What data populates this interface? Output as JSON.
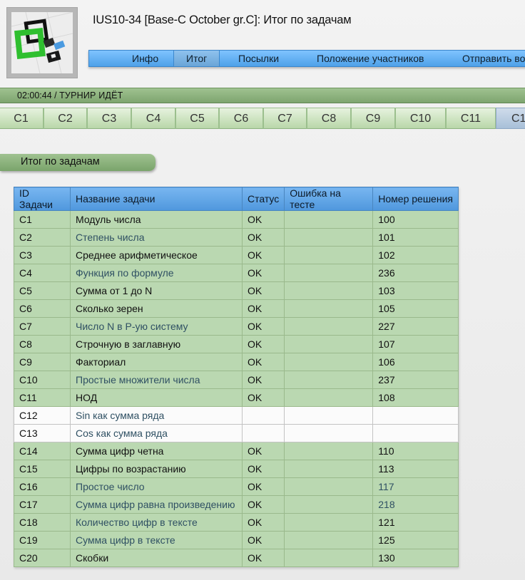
{
  "header": {
    "title": "IUS10-34 [Base-C October gr.C]: Итог по задачам"
  },
  "menu": [
    {
      "label": "Инфо",
      "active": false
    },
    {
      "label": "Итог",
      "active": true
    },
    {
      "label": "Посылки",
      "active": false
    },
    {
      "label": "Положение участников",
      "active": false
    },
    {
      "label": "Отправить во",
      "active": false
    }
  ],
  "status": {
    "time": "02:00:44",
    "separator": " / ",
    "state": "ТУРНИР ИДЁТ"
  },
  "tabs": [
    "C1",
    "C2",
    "C3",
    "C4",
    "C5",
    "C6",
    "C7",
    "C8",
    "C9",
    "C10",
    "C11",
    "C1"
  ],
  "section": {
    "heading": "Итог по задачам"
  },
  "table": {
    "headers": [
      "ID Задачи",
      "Название задачи",
      "Статус",
      "Ошибка на тесте",
      "Номер решения"
    ],
    "rows": [
      {
        "id": "C1",
        "name": "Модуль числа",
        "status": "OK",
        "error": "",
        "solution": "100",
        "solved": true,
        "name_dim": false,
        "num_dim": false
      },
      {
        "id": "C2",
        "name": "Степень числа",
        "status": "OK",
        "error": "",
        "solution": "101",
        "solved": true,
        "name_dim": true,
        "num_dim": false
      },
      {
        "id": "C3",
        "name": "Среднее арифметическое",
        "status": "OK",
        "error": "",
        "solution": "102",
        "solved": true,
        "name_dim": false,
        "num_dim": false
      },
      {
        "id": "C4",
        "name": "Функция по формуле",
        "status": "OK",
        "error": "",
        "solution": "236",
        "solved": true,
        "name_dim": true,
        "num_dim": false
      },
      {
        "id": "C5",
        "name": "Сумма от 1 до N",
        "status": "OK",
        "error": "",
        "solution": "103",
        "solved": true,
        "name_dim": false,
        "num_dim": false
      },
      {
        "id": "C6",
        "name": "Сколько зерен",
        "status": "OK",
        "error": "",
        "solution": "105",
        "solved": true,
        "name_dim": false,
        "num_dim": false
      },
      {
        "id": "C7",
        "name": "Число N в P-ую систему",
        "status": "OK",
        "error": "",
        "solution": "227",
        "solved": true,
        "name_dim": true,
        "num_dim": false
      },
      {
        "id": "C8",
        "name": "Строчную в заглавную",
        "status": "OK",
        "error": "",
        "solution": "107",
        "solved": true,
        "name_dim": false,
        "num_dim": false
      },
      {
        "id": "C9",
        "name": "Факториал",
        "status": "OK",
        "error": "",
        "solution": "106",
        "solved": true,
        "name_dim": false,
        "num_dim": false
      },
      {
        "id": "C10",
        "name": "Простые множители числа",
        "status": "OK",
        "error": "",
        "solution": "237",
        "solved": true,
        "name_dim": true,
        "num_dim": false
      },
      {
        "id": "C11",
        "name": "НОД",
        "status": "OK",
        "error": "",
        "solution": "108",
        "solved": true,
        "name_dim": false,
        "num_dim": false
      },
      {
        "id": "C12",
        "name": "Sin как сумма ряда",
        "status": "",
        "error": "",
        "solution": "",
        "solved": false,
        "name_dim": true,
        "num_dim": false
      },
      {
        "id": "C13",
        "name": "Cos как сумма ряда",
        "status": "",
        "error": "",
        "solution": "",
        "solved": false,
        "name_dim": true,
        "num_dim": false
      },
      {
        "id": "C14",
        "name": "Сумма цифр четна",
        "status": "OK",
        "error": "",
        "solution": "110",
        "solved": true,
        "name_dim": false,
        "num_dim": false
      },
      {
        "id": "C15",
        "name": "Цифры по возрастанию",
        "status": "OK",
        "error": "",
        "solution": "113",
        "solved": true,
        "name_dim": false,
        "num_dim": false
      },
      {
        "id": "C16",
        "name": "Простое число",
        "status": "OK",
        "error": "",
        "solution": "117",
        "solved": true,
        "name_dim": true,
        "num_dim": true
      },
      {
        "id": "C17",
        "name": "Сумма цифр равна произведению",
        "status": "OK",
        "error": "",
        "solution": "218",
        "solved": true,
        "name_dim": true,
        "num_dim": true
      },
      {
        "id": "C18",
        "name": "Количество цифр в тексте",
        "status": "OK",
        "error": "",
        "solution": "121",
        "solved": true,
        "name_dim": true,
        "num_dim": false
      },
      {
        "id": "C19",
        "name": "Сумма цифр в тексте",
        "status": "OK",
        "error": "",
        "solution": "125",
        "solved": true,
        "name_dim": true,
        "num_dim": false
      },
      {
        "id": "C20",
        "name": "Скобки",
        "status": "OK",
        "error": "",
        "solution": "130",
        "solved": true,
        "name_dim": false,
        "num_dim": false
      }
    ]
  }
}
